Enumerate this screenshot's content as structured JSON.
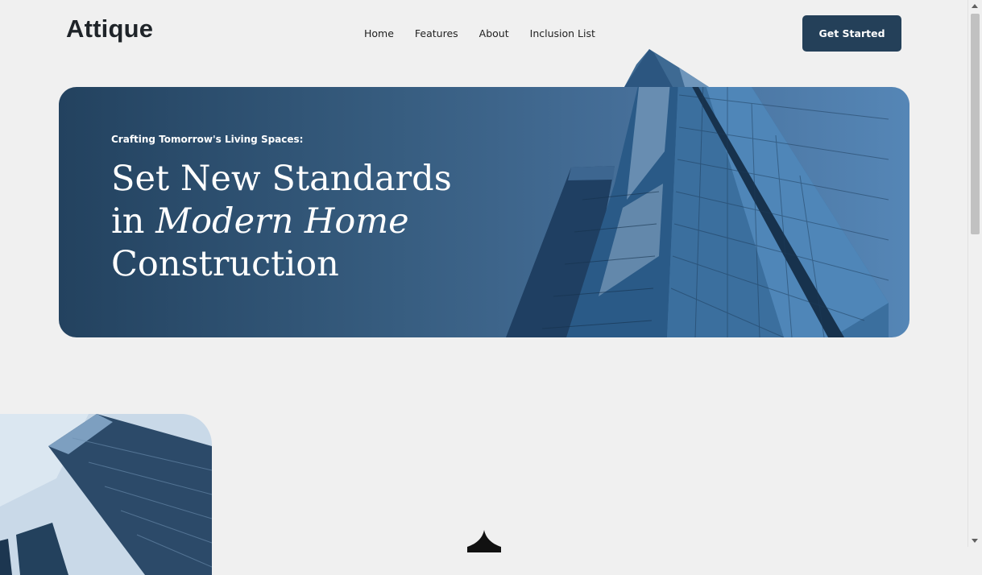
{
  "header": {
    "brand": "Attique",
    "nav": [
      "Home",
      "Features",
      "About",
      "Inclusion List"
    ],
    "cta_label": "Get Started"
  },
  "hero": {
    "eyebrow": "Crafting Tomorrow's Living Spaces:",
    "headline_line1": "Set New Standards",
    "headline_line2_prefix": "in ",
    "headline_line2_em": "Modern Home",
    "headline_line3": "Construction"
  },
  "colors": {
    "page_bg": "#f0f0f0",
    "brand_text": "#1f2429",
    "cta_bg": "#244059",
    "hero_gradient_start": "#23425f",
    "hero_gradient_end": "#5586b6"
  },
  "icons": [
    "building-photo",
    "sparkle-icon"
  ]
}
